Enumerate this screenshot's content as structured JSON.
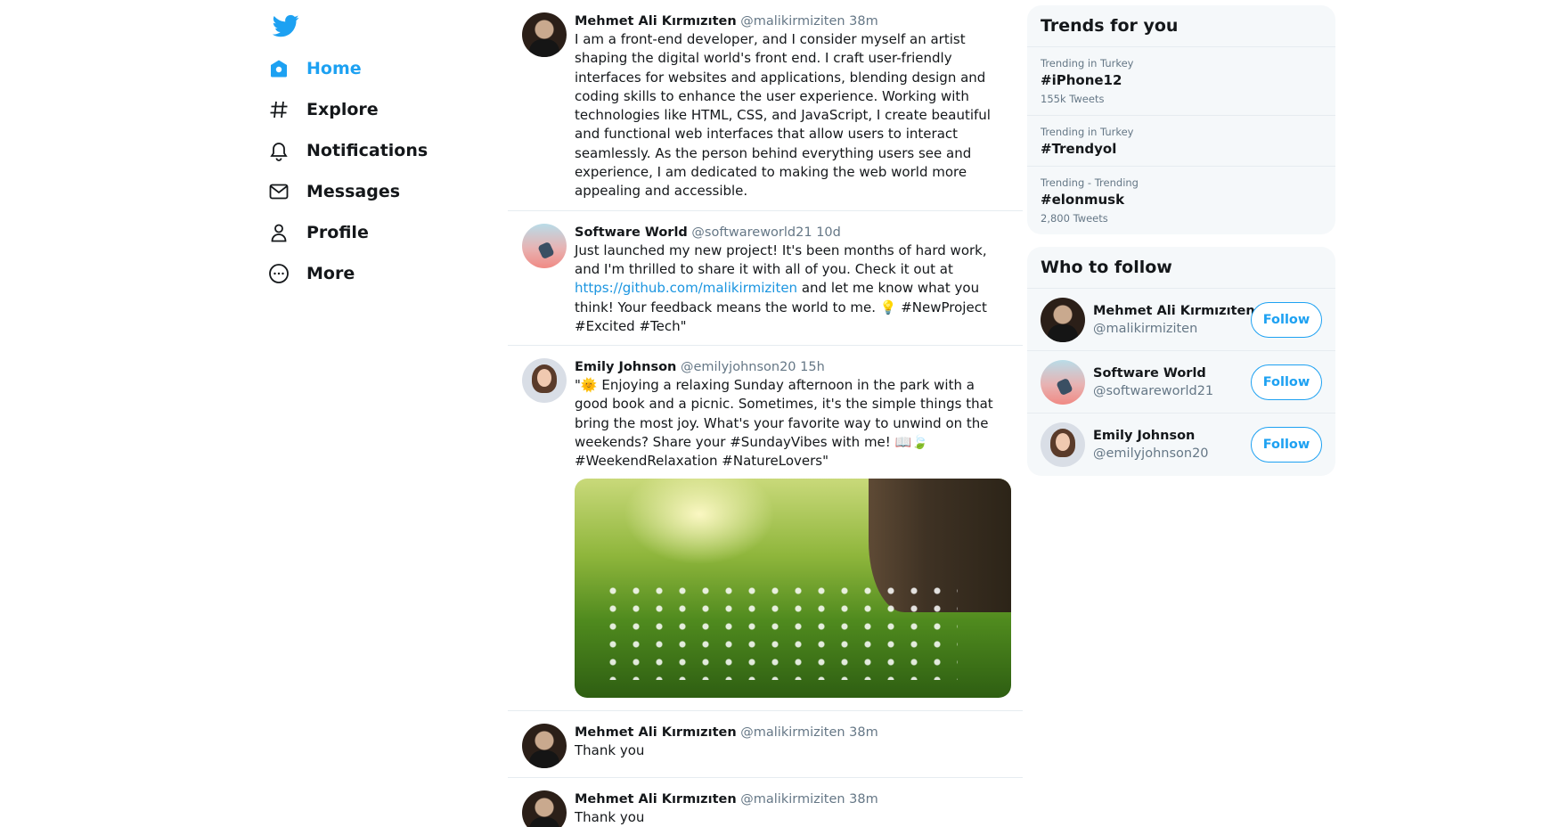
{
  "brand": {
    "logo_icon": "twitter-bird-icon",
    "accent_color": "#1da1f2"
  },
  "nav": [
    {
      "label": "Home",
      "icon": "home-icon",
      "active": true
    },
    {
      "label": "Explore",
      "icon": "hashtag-icon",
      "active": false
    },
    {
      "label": "Notifications",
      "icon": "bell-icon",
      "active": false
    },
    {
      "label": "Messages",
      "icon": "envelope-icon",
      "active": false
    },
    {
      "label": "Profile",
      "icon": "user-icon",
      "active": false
    },
    {
      "label": "More",
      "icon": "more-circle-icon",
      "active": false
    }
  ],
  "feed": [
    {
      "name": "Mehmet Ali Kırmızıten",
      "handle": "@malikirmiziten",
      "time": "38m",
      "text": "I am a front-end developer, and I consider myself an artist shaping the digital world's front end. I craft user-friendly interfaces for websites and applications, blending design and coding skills to enhance the user experience. Working with technologies like HTML, CSS, and JavaScript, I create beautiful and functional web interfaces that allow users to interact seamlessly. As the person behind everything users see and experience, I am dedicated to making the web world more appealing and accessible."
    },
    {
      "name": "Software World",
      "handle": "@softwareworld21",
      "time": "10d",
      "text_before": "Just launched my new project! It's been months of hard work, and I'm thrilled to share it with all of you. Check it out at ",
      "link": "https://github.com/malikirmiziten",
      "text_after": " and let me know what you think! Your feedback means the world to me. 💡 #NewProject #Excited #Tech\""
    },
    {
      "name": "Emily Johnson",
      "handle": "@emilyjohnson20",
      "time": "15h",
      "text": "\"🌞 Enjoying a relaxing Sunday afternoon in the park with a good book and a picnic. Sometimes, it's the simple things that bring the most joy. What's your favorite way to unwind on the weekends? Share your #SundayVibes with me! 📖🍃 #WeekendRelaxation #NatureLovers\""
    },
    {
      "name": "Mehmet Ali Kırmızıten",
      "handle": "@malikirmiziten",
      "time": "38m",
      "text": "Thank you"
    },
    {
      "name": "Mehmet Ali Kırmızıten",
      "handle": "@malikirmiziten",
      "time": "38m",
      "text": "Thank you"
    }
  ],
  "trends": {
    "title": "Trends for you",
    "items": [
      {
        "context": "Trending in Turkey",
        "tag": "#iPhone12",
        "count": "155k Tweets"
      },
      {
        "context": "Trending in Turkey",
        "tag": "#Trendyol",
        "count": ""
      },
      {
        "context": "Trending - Trending",
        "tag": "#elonmusk",
        "count": "2,800 Tweets"
      }
    ]
  },
  "who_to_follow": {
    "title": "Who to follow",
    "button_label": "Follow",
    "items": [
      {
        "name": "Mehmet Ali Kırmızıten",
        "handle": "@malikirmiziten"
      },
      {
        "name": "Software World",
        "handle": "@softwareworld21"
      },
      {
        "name": "Emily Johnson",
        "handle": "@emilyjohnson20"
      }
    ]
  }
}
